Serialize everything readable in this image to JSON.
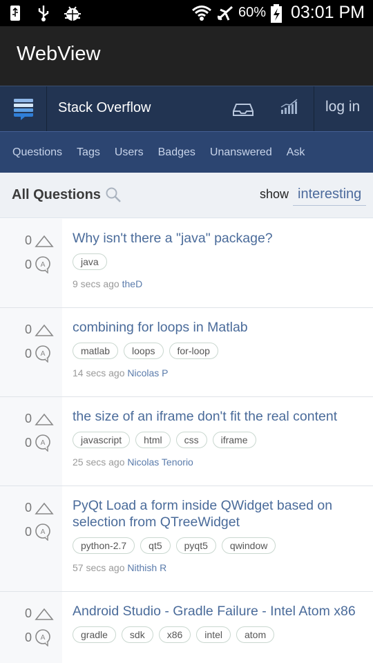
{
  "statusbar": {
    "battery_pct": "60%",
    "time": "03:01 PM"
  },
  "appbar": {
    "title": "WebView"
  },
  "topbar": {
    "site_name": "Stack Overflow",
    "login": "log in"
  },
  "nav": {
    "items": [
      "Questions",
      "Tags",
      "Users",
      "Badges",
      "Unanswered",
      "Ask"
    ]
  },
  "subhead": {
    "heading": "All Questions",
    "show_label": "show",
    "filter_value": "interesting"
  },
  "questions": [
    {
      "votes": "0",
      "answers": "0",
      "title": "Why isn't there a \"java\" package?",
      "tags": [
        "java"
      ],
      "time": "9 secs ago",
      "user": "theD"
    },
    {
      "votes": "0",
      "answers": "0",
      "title": "combining for loops in Matlab",
      "tags": [
        "matlab",
        "loops",
        "for-loop"
      ],
      "time": "14 secs ago",
      "user": "Nicolas P"
    },
    {
      "votes": "0",
      "answers": "0",
      "title": "the size of an iframe don't fit the real content",
      "tags": [
        "javascript",
        "html",
        "css",
        "iframe"
      ],
      "time": "25 secs ago",
      "user": "Nicolas Tenorio"
    },
    {
      "votes": "0",
      "answers": "0",
      "title": "PyQt Load a form inside QWidget based on selection from QTreeWidget",
      "tags": [
        "python-2.7",
        "qt5",
        "pyqt5",
        "qwindow"
      ],
      "time": "57 secs ago",
      "user": "Nithish R"
    },
    {
      "votes": "0",
      "answers": "0",
      "title": "Android Studio - Gradle Failure - Intel Atom x86",
      "tags": [
        "gradle",
        "sdk",
        "x86",
        "intel",
        "atom"
      ],
      "time": "",
      "user": ""
    }
  ]
}
